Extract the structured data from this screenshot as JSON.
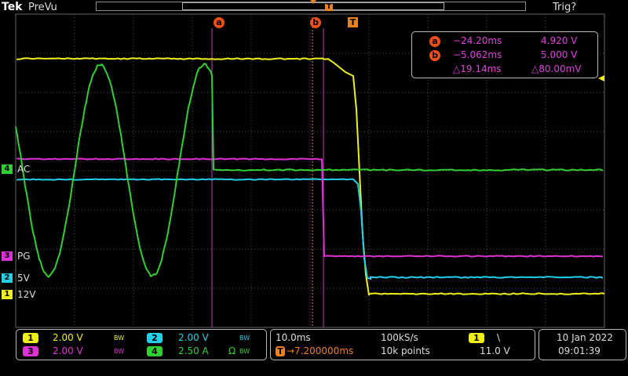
{
  "topbar": {
    "brand": "Tek",
    "mode": "PreVu",
    "trig_status": "Trig?",
    "record_marker": "T"
  },
  "colors": {
    "ch1": "#f0f018",
    "ch2": "#20d0e8",
    "ch3": "#e030d8",
    "ch4": "#30d030",
    "cursor": "#f05018",
    "trigger": "#f08018",
    "readout": "#e040e0"
  },
  "cursors": {
    "a_label": "a",
    "b_label": "b",
    "trig_label": "T"
  },
  "readout": {
    "a_label": "a",
    "a_time": "−24.20ms",
    "a_value": "4.920 V",
    "b_label": "b",
    "b_time": "−5.062ms",
    "b_value": "5.000 V",
    "delta_time": "△19.14ms",
    "delta_value": "△80.00mV"
  },
  "channel_labels": {
    "ch4_num": "4",
    "ch4_name": "AC",
    "ch3_num": "3",
    "ch3_name": "PG",
    "ch2_num": "2",
    "ch2_name": "5V",
    "ch1_num": "1",
    "ch1_name": "12V"
  },
  "bottom": {
    "ch1_num": "1",
    "ch1_scale": "2.00 V",
    "ch2_num": "2",
    "ch2_scale": "2.00 V",
    "ch3_num": "3",
    "ch3_scale": "2.00 V",
    "ch4_num": "4",
    "ch4_scale": "2.50 A",
    "ch4_term": "Ω",
    "bw_symbol": "BW",
    "timebase": "10.0ms",
    "sample_rate": "100kS/s",
    "trig_pos": "→7.200000ms",
    "record_length": "10k points",
    "trig_source": "1",
    "trig_slope": "\\",
    "trig_level": "11.0 V",
    "date": "10 Jan  2022",
    "time": "09:01:39"
  }
}
